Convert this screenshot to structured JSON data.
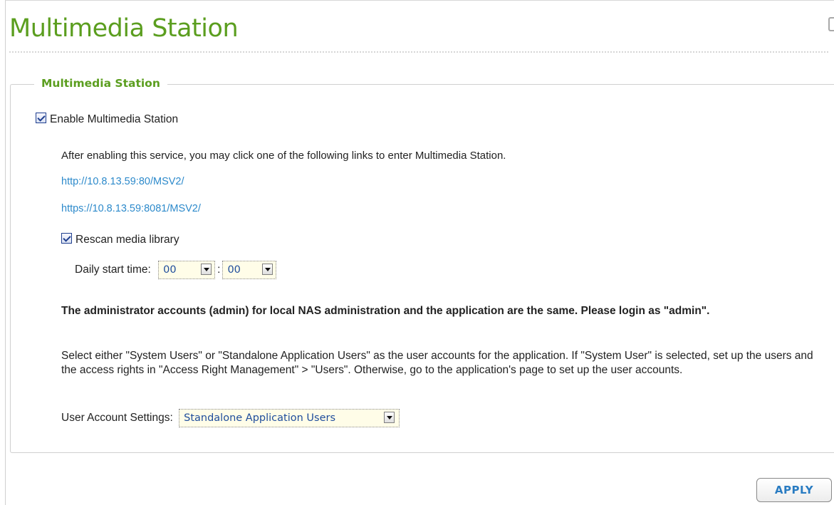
{
  "page": {
    "title": "Multimedia Station"
  },
  "section": {
    "legend": "Multimedia Station",
    "enable_label": "Enable Multimedia Station",
    "enable_checked": true,
    "intro": "After enabling this service, you may click one of the following links to enter Multimedia Station.",
    "links": [
      "http://10.8.13.59:80/MSV2/",
      "https://10.8.13.59:8081/MSV2/"
    ],
    "rescan_label": "Rescan media library",
    "rescan_checked": true,
    "start_time_label": "Daily start time:",
    "hour_value": "00",
    "time_separator": ":",
    "minute_value": "00",
    "admin_note": "The administrator accounts (admin) for local NAS administration and the application are the same. Please login as \"admin\".",
    "accounts_description": "Select either \"System Users\" or \"Standalone Application Users\" as the user accounts for the application. If \"System User\" is selected, set up the users and the access rights in \"Access Right Management\" > \"Users\". Otherwise, go to the application's page to set up the user accounts.",
    "user_account_label": "User Account Settings:",
    "user_account_value": "Standalone Application Users"
  },
  "footer": {
    "apply_label": "APPLY"
  },
  "colors": {
    "accent_green": "#5b9e1f",
    "link_blue": "#2d8acb",
    "select_text": "#1f4d9c"
  }
}
